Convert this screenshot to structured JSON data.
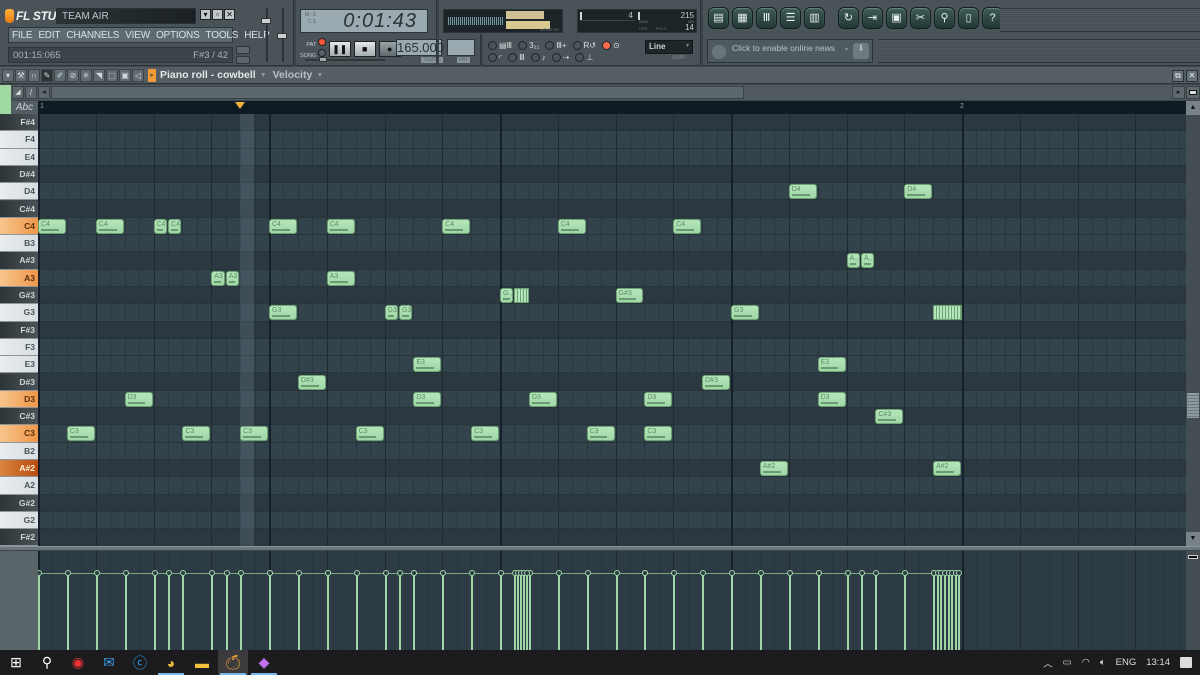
{
  "app": {
    "name": "FL STUDIO",
    "title": "TEAM AIR",
    "window_buttons": [
      "▾",
      "▫",
      "✕"
    ],
    "menu": [
      "FILE",
      "EDIT",
      "CHANNELS",
      "VIEW",
      "OPTIONS",
      "TOOLS",
      "HELP"
    ],
    "hint_left": "001:15:065",
    "hint_right": "F#3 / 42"
  },
  "transport": {
    "time": "0:01:43",
    "time_labels": [
      "M:S",
      "CS"
    ],
    "pat_label": "PAT",
    "song_label": "SONG",
    "pat_active": true,
    "tempo": "165.000",
    "tempo_label": "TEMPO",
    "pattern_label": "PAT",
    "monitor_label": "MONITOR",
    "cpu_label": "CPU",
    "poly_label": "POLY",
    "ram_label": "RAM",
    "mb_label": "MB",
    "cpu_value": "4",
    "ram_value": "215",
    "poly_value": "14",
    "snap_value": "Line",
    "snap_label": "SNAP"
  },
  "options": [
    {
      "icon": "typing-keyboard-icon",
      "label": "▤Ⅲ",
      "on": false
    },
    {
      "icon": "countdown-icon",
      "label": "3₂₁",
      "on": false
    },
    {
      "icon": "step-edit-icon",
      "label": "Ⅲ+",
      "on": false
    },
    {
      "icon": "loop-record-icon",
      "label": "R↺",
      "on": false
    },
    {
      "icon": "record-icon",
      "label": "⊙",
      "on": true
    },
    {
      "icon": "metronome-icon",
      "label": "◜",
      "on": false
    },
    {
      "icon": "wait-icon",
      "label": "Ⅲ",
      "on": false
    },
    {
      "icon": "blend-icon",
      "label": "♪",
      "on": false
    },
    {
      "icon": "arrow-icon",
      "label": "⇢",
      "on": false
    },
    {
      "icon": "joystick-icon",
      "label": "⊥",
      "on": false
    }
  ],
  "toolbar_buttons": [
    {
      "name": "playlist-button",
      "glyph": "▤"
    },
    {
      "name": "step-sequencer-button",
      "glyph": "▦"
    },
    {
      "name": "piano-roll-button",
      "glyph": "Ⅲ"
    },
    {
      "name": "browser-button",
      "glyph": "☰"
    },
    {
      "name": "mixer-button",
      "glyph": "▥"
    },
    {
      "name": "refresh-button",
      "glyph": "↻"
    },
    {
      "name": "export-button",
      "glyph": "⇥"
    },
    {
      "name": "save-button",
      "glyph": "▣"
    },
    {
      "name": "cut-button",
      "glyph": "✂"
    },
    {
      "name": "search-button",
      "glyph": "⚲"
    },
    {
      "name": "file-button",
      "glyph": "▯"
    },
    {
      "name": "help-button",
      "glyph": "?"
    }
  ],
  "news": {
    "text": "Click to enable online news"
  },
  "piano_roll": {
    "title": "Piano roll - cowbell",
    "target": "Velocity",
    "abc": "Abc",
    "bar_labels": [
      "1",
      "2"
    ],
    "note_color": "#a8ddae",
    "keys": [
      "F#4",
      "F4",
      "E4",
      "D#4",
      "D4",
      "C#4",
      "C4",
      "B3",
      "A#3",
      "A3",
      "G#3",
      "G3",
      "F#3",
      "F3",
      "E3",
      "D#3",
      "D3",
      "C#3",
      "C3",
      "B2",
      "A#2",
      "A2",
      "G#2",
      "G2",
      "F#2"
    ],
    "highlight_keys": [
      "C4",
      "A3",
      "D3",
      "C3"
    ],
    "selected_key": "A#2",
    "steps_per_bar": 64,
    "notes": [
      {
        "key": "C4",
        "step": 0,
        "len": 2,
        "label": "C4"
      },
      {
        "key": "C4",
        "step": 4,
        "len": 2,
        "label": "C4"
      },
      {
        "key": "C4",
        "step": 8,
        "len": 1,
        "label": "C4"
      },
      {
        "key": "C4",
        "step": 9,
        "len": 1,
        "label": "C4"
      },
      {
        "key": "C4",
        "step": 16,
        "len": 2,
        "label": "C4"
      },
      {
        "key": "C4",
        "step": 20,
        "len": 2,
        "label": "C4"
      },
      {
        "key": "C4",
        "step": 28,
        "len": 2,
        "label": "C4"
      },
      {
        "key": "C4",
        "step": 36,
        "len": 2,
        "label": "C4"
      },
      {
        "key": "C4",
        "step": 44,
        "len": 2,
        "label": "C4"
      },
      {
        "key": "D4",
        "step": 52,
        "len": 2,
        "label": "D4"
      },
      {
        "key": "D4",
        "step": 60,
        "len": 2,
        "label": "D4"
      },
      {
        "key": "A#3",
        "step": 56,
        "len": 1,
        "label": "A..."
      },
      {
        "key": "A#3",
        "step": 57,
        "len": 1,
        "label": "A..."
      },
      {
        "key": "A3",
        "step": 12,
        "len": 1,
        "label": "A3"
      },
      {
        "key": "A3",
        "step": 13,
        "len": 1,
        "label": "A3"
      },
      {
        "key": "A3",
        "step": 20,
        "len": 2,
        "label": "A3"
      },
      {
        "key": "G#3",
        "step": 32,
        "len": 1,
        "label": "G..."
      },
      {
        "key": "G#3",
        "step": 40,
        "len": 2,
        "label": "G#3"
      },
      {
        "key": "G3",
        "step": 16,
        "len": 2,
        "label": "G3"
      },
      {
        "key": "G3",
        "step": 24,
        "len": 1,
        "label": "G3"
      },
      {
        "key": "G3",
        "step": 25,
        "len": 1,
        "label": "G3"
      },
      {
        "key": "G3",
        "step": 48,
        "len": 2,
        "label": "G3"
      },
      {
        "key": "E3",
        "step": 26,
        "len": 2,
        "label": "E3"
      },
      {
        "key": "E3",
        "step": 54,
        "len": 2,
        "label": "E3"
      },
      {
        "key": "D#3",
        "step": 18,
        "len": 2,
        "label": "D#3"
      },
      {
        "key": "D#3",
        "step": 46,
        "len": 2,
        "label": "D#3"
      },
      {
        "key": "D3",
        "step": 6,
        "len": 2,
        "label": "D3"
      },
      {
        "key": "D3",
        "step": 26,
        "len": 2,
        "label": "D3"
      },
      {
        "key": "D3",
        "step": 34,
        "len": 2,
        "label": "D3"
      },
      {
        "key": "D3",
        "step": 42,
        "len": 2,
        "label": "D3"
      },
      {
        "key": "D3",
        "step": 54,
        "len": 2,
        "label": "D3"
      },
      {
        "key": "C#3",
        "step": 58,
        "len": 2,
        "label": "C#3"
      },
      {
        "key": "C3",
        "step": 2,
        "len": 2,
        "label": "C3"
      },
      {
        "key": "C3",
        "step": 10,
        "len": 2,
        "label": "C3"
      },
      {
        "key": "C3",
        "step": 14,
        "len": 2,
        "label": "C3"
      },
      {
        "key": "C3",
        "step": 22,
        "len": 2,
        "label": "C3"
      },
      {
        "key": "C3",
        "step": 30,
        "len": 2,
        "label": "C3"
      },
      {
        "key": "C3",
        "step": 38,
        "len": 2,
        "label": "C3"
      },
      {
        "key": "C3",
        "step": 42,
        "len": 2,
        "label": "C3"
      },
      {
        "key": "A#2",
        "step": 50,
        "len": 2,
        "label": "A#2"
      },
      {
        "key": "A#2",
        "step": 62,
        "len": 2,
        "label": "A#2"
      }
    ],
    "rolls": [
      {
        "key": "G#3",
        "step": 33,
        "len": 1,
        "count": 5
      },
      {
        "key": "G3",
        "step": 62,
        "len": 2,
        "count": 8
      }
    ],
    "velocity_percent": 78
  },
  "taskbar": {
    "apps": [
      "start-icon",
      "search-icon",
      "app-red-icon",
      "mail-icon",
      "app-c-icon",
      "chrome-icon",
      "file-explorer-icon",
      "fl-studio-icon",
      "paint-icon"
    ],
    "tray_language": "ENG",
    "clock": "13:14"
  }
}
